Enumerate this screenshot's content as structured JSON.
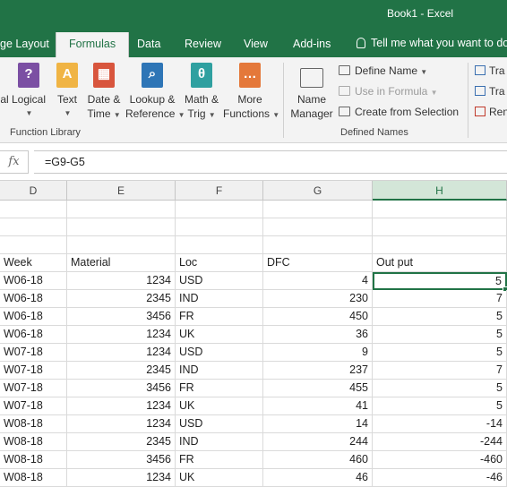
{
  "window": {
    "title": "Book1  -  Excel"
  },
  "tabs": [
    {
      "label": "ge Layout"
    },
    {
      "label": "Formulas",
      "active": true
    },
    {
      "label": "Data"
    },
    {
      "label": "Review"
    },
    {
      "label": "View"
    },
    {
      "label": "Add-ins"
    }
  ],
  "tell_me": "Tell me what you want to do",
  "function_library": {
    "label": "Function Library",
    "buttons": [
      {
        "line1": "al",
        "line2": "",
        "icon": "partial-icon"
      },
      {
        "line1": "Logical",
        "line2": "",
        "icon": "logical-icon",
        "glyph": "?"
      },
      {
        "line1": "Text",
        "line2": "",
        "icon": "text-icon",
        "glyph": "A"
      },
      {
        "line1": "Date &",
        "line2": "Time",
        "icon": "date-time-icon",
        "glyph": "▦"
      },
      {
        "line1": "Lookup &",
        "line2": "Reference",
        "icon": "lookup-icon",
        "glyph": "⌕"
      },
      {
        "line1": "Math &",
        "line2": "Trig",
        "icon": "math-trig-icon",
        "glyph": "θ"
      },
      {
        "line1": "More",
        "line2": "Functions",
        "icon": "more-functions-icon",
        "glyph": "…"
      }
    ]
  },
  "defined_names": {
    "label": "Defined Names",
    "name_manager_line1": "Name",
    "name_manager_line2": "Manager",
    "define_name": "Define Name",
    "use_in_formula": "Use in Formula",
    "create_from_selection": "Create from Selection"
  },
  "formula_auditing": {
    "row1": "Tra",
    "row2": "Tra",
    "row3": "Ren"
  },
  "formula_bar": {
    "fx": "fx",
    "value": "=G9-G5"
  },
  "columns": [
    "D",
    "E",
    "F",
    "G",
    "H"
  ],
  "selected_column": "H",
  "header_row": {
    "week": "Week",
    "material": "Material",
    "loc": "Loc",
    "dfc": "DFC",
    "output": "Out put"
  },
  "rows": [
    {
      "week": "W06-18",
      "material": "1234",
      "loc": "USD",
      "dfc": "4",
      "output": "5"
    },
    {
      "week": "W06-18",
      "material": "2345",
      "loc": "IND",
      "dfc": "230",
      "output": "7"
    },
    {
      "week": "W06-18",
      "material": "3456",
      "loc": "FR",
      "dfc": "450",
      "output": "5"
    },
    {
      "week": "W06-18",
      "material": "1234",
      "loc": "UK",
      "dfc": "36",
      "output": "5"
    },
    {
      "week": "W07-18",
      "material": "1234",
      "loc": "USD",
      "dfc": "9",
      "output": "5"
    },
    {
      "week": "W07-18",
      "material": "2345",
      "loc": "IND",
      "dfc": "237",
      "output": "7"
    },
    {
      "week": "W07-18",
      "material": "3456",
      "loc": "FR",
      "dfc": "455",
      "output": "5"
    },
    {
      "week": "W07-18",
      "material": "1234",
      "loc": "UK",
      "dfc": "41",
      "output": "5"
    },
    {
      "week": "W08-18",
      "material": "1234",
      "loc": "USD",
      "dfc": "14",
      "output": "-14"
    },
    {
      "week": "W08-18",
      "material": "2345",
      "loc": "IND",
      "dfc": "244",
      "output": "-244"
    },
    {
      "week": "W08-18",
      "material": "3456",
      "loc": "FR",
      "dfc": "460",
      "output": "-460"
    },
    {
      "week": "W08-18",
      "material": "1234",
      "loc": "UK",
      "dfc": "46",
      "output": "-46"
    }
  ],
  "colors": {
    "accent": "#217346",
    "ribbon_bg": "#f3f3f3"
  }
}
